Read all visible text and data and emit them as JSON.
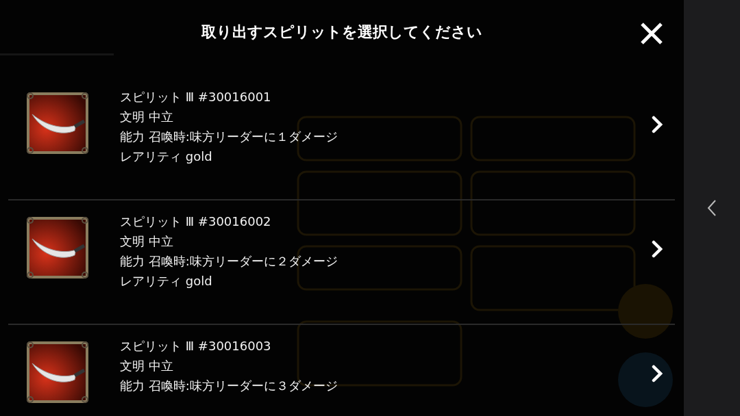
{
  "dialog": {
    "title": "取り出すスピリットを選択してください",
    "items": [
      {
        "lines": [
          "スピリット Ⅲ #30016001",
          "文明 中立",
          "能力 召喚時:味方リーダーに１ダメージ",
          "レアリティ gold"
        ]
      },
      {
        "lines": [
          "スピリット Ⅲ #30016002",
          "文明 中立",
          "能力 召喚時:味方リーダーに２ダメージ",
          "レアリティ gold"
        ]
      },
      {
        "lines": [
          "スピリット Ⅲ #30016003",
          "文明 中立",
          "能力 召喚時:味方リーダーに３ダメージ"
        ]
      }
    ]
  }
}
